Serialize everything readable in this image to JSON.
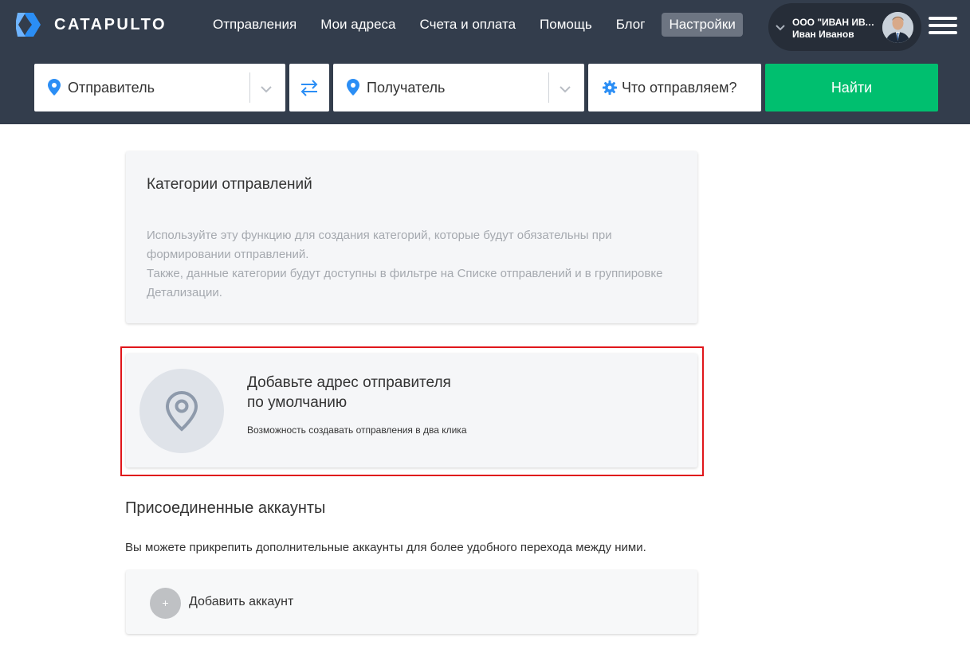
{
  "brand": {
    "name": "CATAPULTO",
    "accent": "#2b8ef5"
  },
  "nav": {
    "items": [
      {
        "label": "Отправления"
      },
      {
        "label": "Мои адреса"
      },
      {
        "label": "Счета и оплата"
      },
      {
        "label": "Помощь"
      },
      {
        "label": "Блог"
      },
      {
        "label": "Настройки",
        "active": true
      }
    ]
  },
  "account": {
    "org": "ООО \"ИВАН ИВАН...",
    "user": "Иван Иванов"
  },
  "search": {
    "sender_placeholder": "Отправитель",
    "receiver_placeholder": "Получатель",
    "cargo_placeholder": "Что отправляем?",
    "find_label": "Найти",
    "find_color": "#00bf6f"
  },
  "categories": {
    "title": "Категории отправлений",
    "description_1": "Используйте эту функцию для создания категорий, которые будут обязательны при формировании отправлений.",
    "description_2": "Также, данные категории будут доступны в фильтре на Списке отправлений и в группировке Детализации."
  },
  "default_address": {
    "title_line1": "Добавьте адрес отправителя",
    "title_line2": "по умолчанию",
    "subtitle": "Возможность создавать отправления в два клика",
    "highlight_color": "#e0161b"
  },
  "linked_accounts": {
    "heading": "Присоединенные аккаунты",
    "description": "Вы можете прикрепить дополнительные аккаунты для более удобного перехода между ними.",
    "add_icon": "+",
    "add_label": "Добавить аккаунт"
  },
  "icons": [
    "logo-icon",
    "chevron-down-icon",
    "menu-icon",
    "location-pin-icon",
    "swap-arrows-icon",
    "gear-icon",
    "plus-icon"
  ]
}
